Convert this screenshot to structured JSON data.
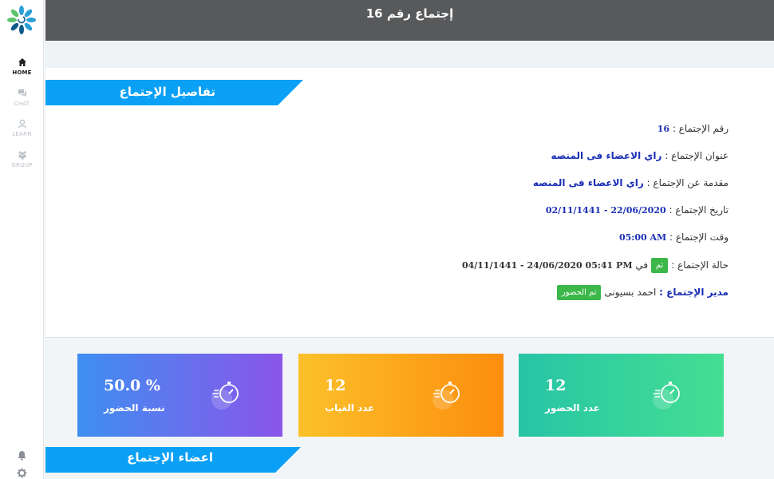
{
  "sidebar": {
    "logo_icon": "flower-logo-icon",
    "items": [
      {
        "label": "HOME",
        "icon": "home-icon",
        "active": true
      },
      {
        "label": "CHAT",
        "icon": "chat-icon",
        "active": false
      },
      {
        "label": "LEARN",
        "icon": "learn-icon",
        "active": false
      },
      {
        "label": "GROUP",
        "icon": "group-icon",
        "active": false
      }
    ],
    "bottom_icons": [
      "bell-icon",
      "gear-icon"
    ]
  },
  "header": {
    "title": "إجتماع رقم 16",
    "background": "#58595b"
  },
  "details_section": {
    "title": "تفاصيل الإجتماع",
    "accent": "#0aa0f5",
    "rows": {
      "number_label": "رقم الإجتماع :",
      "number_value": "16",
      "title_label": "عنوان الإجتماع :",
      "title_value": "راي الاعضاء فى المنصه",
      "intro_label": "مقدمة عن الإجتماع :",
      "intro_value": "راي الاعضاء فى المنصه",
      "date_label": "تاريخ الإجتماع :",
      "date_value": "02/11/1441 - 22/06/2020",
      "time_label": "وقت الإجتماع :",
      "time_value": "05:00 AM",
      "status_label": "حالة الإجتماع :",
      "status_badge": "تم",
      "status_in": "في",
      "status_value": "04/11/1441 - 24/06/2020 05:41 PM",
      "manager_label": "مدير الإجتماع :",
      "manager_name": "احمد بسيونى",
      "manager_badge": "تم الحضور"
    },
    "badge_color": "#3cb74a"
  },
  "stats": [
    {
      "value": "50.0 %",
      "label": "نسبة الحضور",
      "icon": "stopwatch-icon",
      "colors": [
        "#3e8ff1",
        "#8a55ea"
      ]
    },
    {
      "value": "12",
      "label": "عدد الغياب",
      "icon": "stopwatch-icon",
      "colors": [
        "#fbc129",
        "#fd8d0e"
      ]
    },
    {
      "value": "12",
      "label": "عدد الحضور",
      "icon": "stopwatch-icon",
      "colors": [
        "#27c4a6",
        "#44df92"
      ]
    }
  ],
  "members_section": {
    "title": "اعضاء الإجتماع"
  }
}
